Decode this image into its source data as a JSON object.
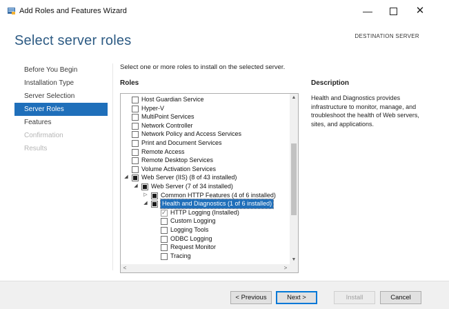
{
  "window": {
    "title": "Add Roles and Features Wizard",
    "minimize_glyph": "—",
    "close_glyph": "✕"
  },
  "header": {
    "page_title": "Select server roles",
    "destination_label": "DESTINATION SERVER"
  },
  "nav": {
    "items": [
      {
        "label": "Before You Begin",
        "state": "normal"
      },
      {
        "label": "Installation Type",
        "state": "normal"
      },
      {
        "label": "Server Selection",
        "state": "normal"
      },
      {
        "label": "Server Roles",
        "state": "selected"
      },
      {
        "label": "Features",
        "state": "normal"
      },
      {
        "label": "Confirmation",
        "state": "disabled"
      },
      {
        "label": "Results",
        "state": "disabled"
      }
    ]
  },
  "main": {
    "instruction": "Select one or more roles to install on the selected server.",
    "roles_heading": "Roles",
    "roles": [
      {
        "label": "Host Guardian Service",
        "level": 0,
        "check": "unchecked",
        "expander": ""
      },
      {
        "label": "Hyper-V",
        "level": 0,
        "check": "unchecked",
        "expander": ""
      },
      {
        "label": "MultiPoint Services",
        "level": 0,
        "check": "unchecked",
        "expander": ""
      },
      {
        "label": "Network Controller",
        "level": 0,
        "check": "unchecked",
        "expander": ""
      },
      {
        "label": "Network Policy and Access Services",
        "level": 0,
        "check": "unchecked",
        "expander": ""
      },
      {
        "label": "Print and Document Services",
        "level": 0,
        "check": "unchecked",
        "expander": ""
      },
      {
        "label": "Remote Access",
        "level": 0,
        "check": "unchecked",
        "expander": ""
      },
      {
        "label": "Remote Desktop Services",
        "level": 0,
        "check": "unchecked",
        "expander": ""
      },
      {
        "label": "Volume Activation Services",
        "level": 0,
        "check": "unchecked",
        "expander": ""
      },
      {
        "label": "Web Server (IIS) (8 of 43 installed)",
        "level": 0,
        "check": "partial",
        "expander": "◢"
      },
      {
        "label": "Web Server (7 of 34 installed)",
        "level": 1,
        "check": "partial",
        "expander": "◢"
      },
      {
        "label": "Common HTTP Features (4 of 6 installed)",
        "level": 2,
        "check": "partial",
        "expander": "▷"
      },
      {
        "label": "Health and Diagnostics (1 of 6 installed)",
        "level": 2,
        "check": "partial",
        "expander": "◢",
        "highlighted": true
      },
      {
        "label": "HTTP Logging (Installed)",
        "level": 3,
        "check": "checked",
        "expander": ""
      },
      {
        "label": "Custom Logging",
        "level": 3,
        "check": "unchecked",
        "expander": ""
      },
      {
        "label": "Logging Tools",
        "level": 3,
        "check": "unchecked",
        "expander": ""
      },
      {
        "label": "ODBC Logging",
        "level": 3,
        "check": "unchecked",
        "expander": ""
      },
      {
        "label": "Request Monitor",
        "level": 3,
        "check": "unchecked",
        "expander": ""
      },
      {
        "label": "Tracing",
        "level": 3,
        "check": "unchecked",
        "expander": ""
      }
    ],
    "scroll": {
      "up_glyph": "▲",
      "down_glyph": "▼",
      "left_glyph": "<",
      "right_glyph": ">"
    }
  },
  "description": {
    "heading": "Description",
    "text": "Health and Diagnostics provides infrastructure to monitor, manage, and troubleshoot the health of Web servers, sites, and applications."
  },
  "footer": {
    "previous_label": "< Previous",
    "next_label": "Next >",
    "install_label": "Install",
    "cancel_label": "Cancel"
  },
  "colors": {
    "accent": "#1f6fba",
    "title": "#2c5a83",
    "footer_bg": "#f0f0f0"
  }
}
